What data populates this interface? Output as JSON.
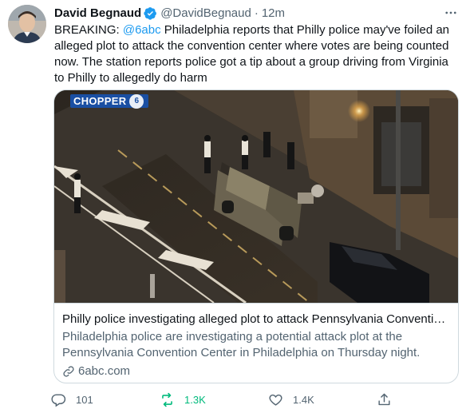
{
  "tweet": {
    "author_name": "David Begnaud",
    "handle": "@DavidBegnaud",
    "separator": "·",
    "time": "12m",
    "text_prefix": "BREAKING: ",
    "mention": "@6abc",
    "text_body": " Philadelphia reports that Philly police may've foiled an alleged plot to attack the convention center where votes are being counted now. The station reports police got a tip about a group driving from Virginia to Philly to allegedly do harm"
  },
  "card": {
    "badge_text": "CHOPPER",
    "badge_logo_text": "6",
    "title": "Philly police investigating alleged plot to attack Pennsylvania Conventio...",
    "description": "Philadelphia police are investigating a potential attack plot at the Pennsylvania Convention Center in Philadelphia on Thursday night.",
    "domain": "6abc.com"
  },
  "actions": {
    "reply_count": "101",
    "retweet_count": "1.3K",
    "like_count": "1.4K"
  },
  "colors": {
    "accent": "#1d9bf0",
    "retweet_active": "#00ba7c",
    "muted": "#536471",
    "border": "#cfd9de"
  },
  "icons": [
    "verified-badge-icon",
    "more-icon",
    "link-icon",
    "reply-icon",
    "retweet-icon",
    "like-icon",
    "share-icon"
  ]
}
